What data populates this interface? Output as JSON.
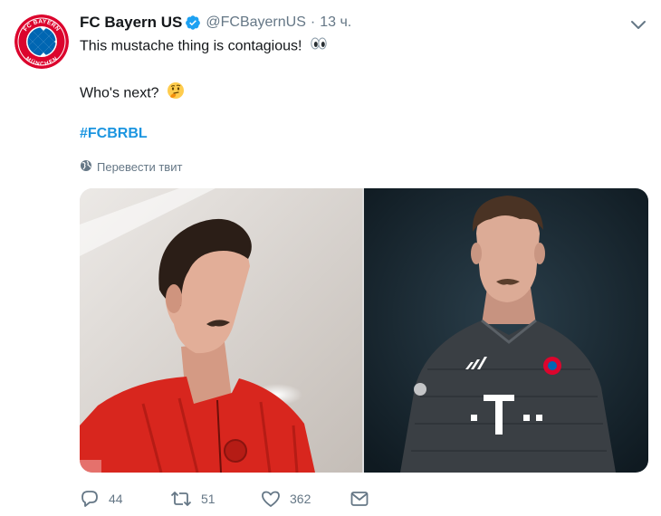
{
  "author": {
    "display_name": "FC Bayern US",
    "handle": "@FCBayernUS",
    "separator": "·",
    "time": "13 ч.",
    "logo_text_top": "FC BAYERN",
    "logo_text_bottom": "MÜNCHEN"
  },
  "tweet": {
    "line1": "This mustache thing is contagious!",
    "line1_emoji": "eyes-emoji",
    "line2": "Who's next?",
    "line2_emoji": "thinking-face-emoji",
    "hashtag": "#FCBRBL",
    "translate_label": "Перевести твит"
  },
  "actions": {
    "replies": "44",
    "retweets": "51",
    "likes": "362"
  },
  "colors": {
    "text": "#14171a",
    "secondary": "#657786",
    "link": "#1b95e0",
    "verified": "#1da1f2",
    "bayern_red": "#dc052d",
    "bayern_blue": "#0066b2"
  },
  "icons": {
    "verified": "verified-badge-icon",
    "caret": "chevron-down-icon",
    "globe": "globe-icon",
    "reply": "reply-icon",
    "retweet": "retweet-icon",
    "like": "heart-icon",
    "dm": "envelope-icon"
  }
}
